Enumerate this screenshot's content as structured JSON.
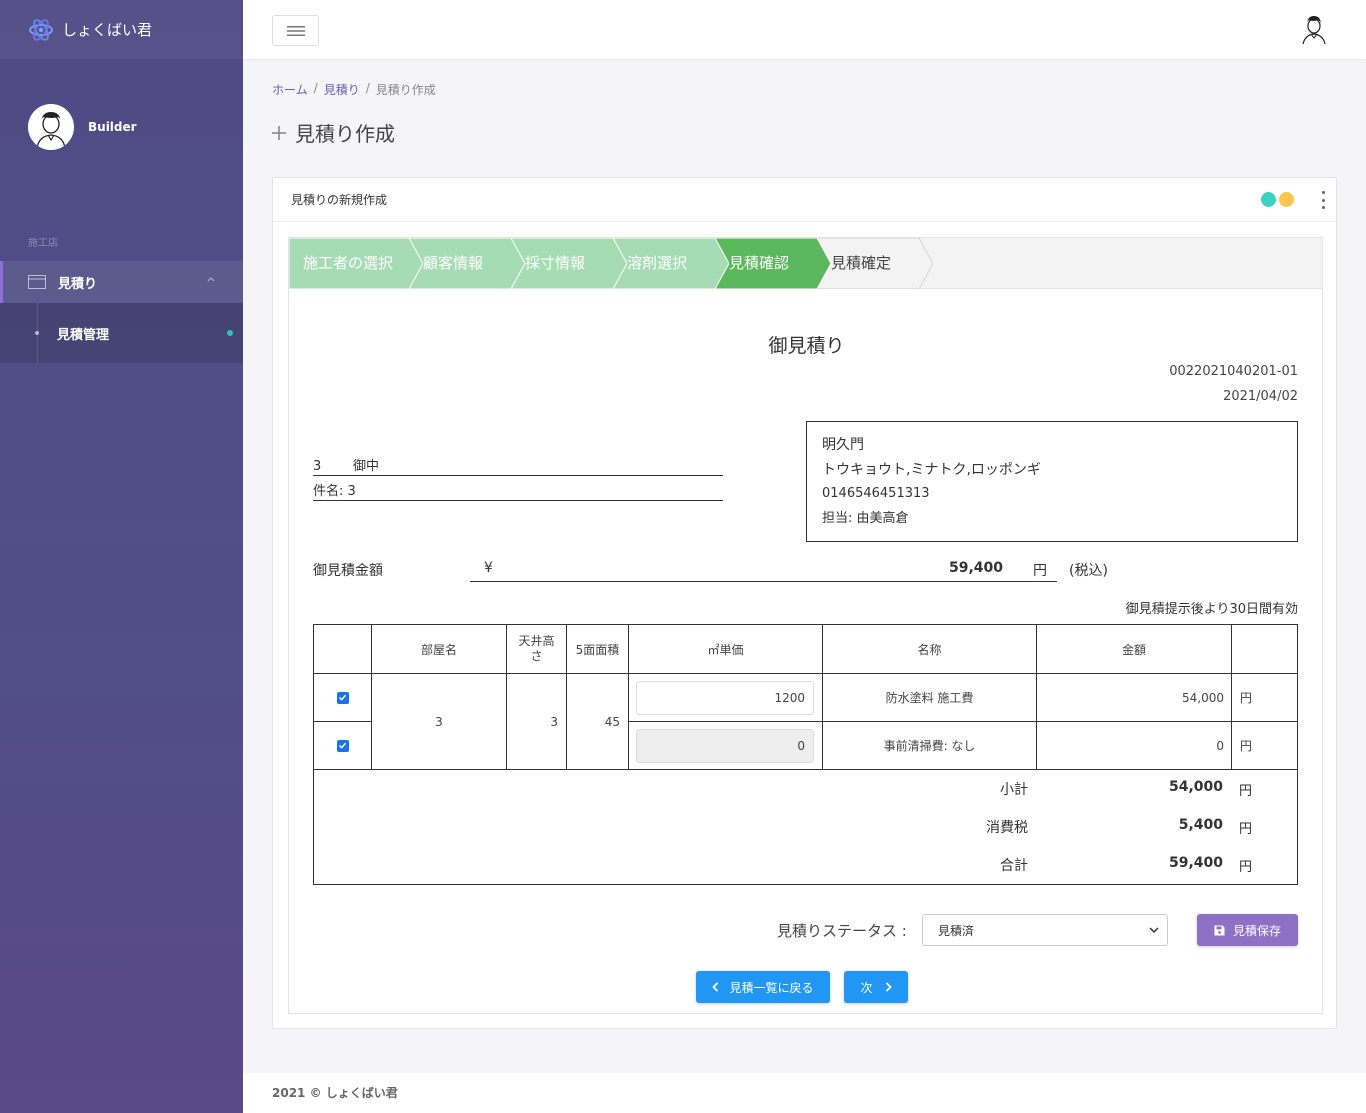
{
  "app": {
    "name": "しょくばい君"
  },
  "user": {
    "name": "Builder"
  },
  "sidebar": {
    "section": "施工店",
    "item": {
      "label": "見積り"
    },
    "sub_item": {
      "label": "見積管理"
    }
  },
  "breadcrumb": {
    "home": "ホーム",
    "sep1": "/",
    "parent": "見積り",
    "sep2": "/",
    "current": "見積り作成"
  },
  "page": {
    "title": "見積り作成"
  },
  "card": {
    "title": "見積りの新規作成",
    "dot_colors": [
      "#3dd1c2",
      "#fcc54b"
    ]
  },
  "steps": [
    {
      "label": "施工者の選択",
      "state": "done"
    },
    {
      "label": "顧客情報",
      "state": "done"
    },
    {
      "label": "採寸情報",
      "state": "done"
    },
    {
      "label": "溶剤選択",
      "state": "done"
    },
    {
      "label": "見積確認",
      "state": "active"
    },
    {
      "label": "見積確定",
      "state": "pending"
    }
  ],
  "colors": {
    "step_done": "#a6dcb4",
    "step_active": "#5cb85c",
    "accent_purple": "#8e70c4",
    "button_blue": "#2196f3"
  },
  "estimate": {
    "title": "御見積り",
    "number": "0022021040201-01",
    "date": "2021/04/02",
    "recipient_name": "3",
    "recipient_suffix": "御中",
    "subject": "件名: 3",
    "company": {
      "name": "明久門",
      "address": "トウキョウト,ミナトク,ロッポンギ",
      "phone": "0146546451313",
      "contact": "担当: 由美高倉"
    },
    "amount_label": "御見積金額",
    "currency_symbol": "¥",
    "amount": "59,400",
    "amount_unit": "円",
    "tax_note": "(税込)",
    "validity": "御見積提示後より30日間有効"
  },
  "table": {
    "headers": [
      "",
      "部屋名",
      "天井高さ",
      "5面面積",
      "㎡単価",
      "名称",
      "金額",
      ""
    ],
    "room": "3",
    "ceiling": "3",
    "area": "45",
    "rows": [
      {
        "checked": true,
        "unit_price": "1200",
        "name": "防水塗料 施工費",
        "amount": "54,000",
        "unit": "円"
      },
      {
        "checked": true,
        "unit_price": "0",
        "name": "事前清掃費: なし",
        "amount": "0",
        "unit": "円"
      }
    ],
    "summary": [
      {
        "label": "小計",
        "value": "54,000",
        "unit": "円"
      },
      {
        "label": "消費税",
        "value": "5,400",
        "unit": "円"
      },
      {
        "label": "合計",
        "value": "59,400",
        "unit": "円"
      }
    ]
  },
  "status": {
    "label": "見積りステータス :",
    "selected": "見積済"
  },
  "buttons": {
    "save": "見積保存",
    "back": "見積一覧に戻る",
    "next": "次"
  },
  "footer": {
    "text": "2021 © しょくばい君"
  }
}
